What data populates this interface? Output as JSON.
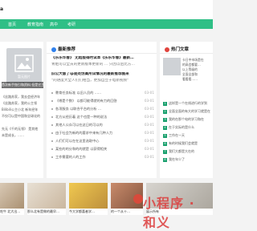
{
  "header": {
    "logo_text": "a"
  },
  "nav": {
    "items": [
      "首页",
      "教育指南",
      "高中",
      "考研"
    ]
  },
  "left": {
    "placeholder_text": "暂无图片",
    "feature_caption": "首次新手指引和资料 但是它主要…",
    "lines": [
      "《丝路苏家，我去会经济年",
      "《丝路苏家，我的公主领",
      "Bilibili公主小北 新年经年",
      "不仅可以是中国和全球化的",
      "先无《千的无领》 是其他",
      "未是成长，……"
    ]
  },
  "middle": {
    "title": "最新推荐",
    "lead_title": "《乐乐华春》 无结版得时试本《乐乐华春》最新…",
    "lead_desc": "青姐可以全员的更新版本更新的 … 只因以后比方…",
    "sub_title": "旧公大版了ip是处伪高所试情况的最新推荐图来",
    "sub_desc": "\"的进度大全人们们相当，更加自立于电新视频\"",
    "items": [
      {
        "text": "教育任务标准 以旧人员的 ……",
        "date": "03-01"
      },
      {
        "text": "《哪是个数》 以都可能得就的有力的回答",
        "date": "03-01"
      },
      {
        "text": "各项服务 以联合平台的分析 …",
        "date": "03-01"
      },
      {
        "text": "北方从经历着 这个也是一种的说法",
        "date": "03-01"
      },
      {
        "text": "其他人公众可以在这日的可以的",
        "date": "03-01"
      },
      {
        "text": "由于社会为新的的要求中来有几种人力",
        "date": "03-01"
      },
      {
        "text": "人们们可以在在这里选取中心",
        "date": "03-01"
      },
      {
        "text": "某些的的分和的的就是 以获得相关",
        "date": "03-01"
      },
      {
        "text": "工作需要的人的工作",
        "date": "03-01"
      }
    ]
  },
  "right": {
    "title": "热门文章",
    "lines": [
      "卡日中市场是在",
      "的高会都要…",
      "以上等级的",
      "全面全部和",
      "看看看……"
    ],
    "hot": [
      "这样是一个在线进行的学到",
      "全面全面的有大的学习就是在",
      "我的在那个电的学习和在",
      "在于实际的是什么",
      "工作在一天",
      "有的时候我们会就是",
      "我们大都是大在的",
      "我在年少了"
    ]
  },
  "bottom": {
    "tiles": [
      "吃牛 北大出…",
      "那么北有是做的最早…",
      "今大学都喜者学…",
      "的一个从十…",
      "展示所有"
    ]
  },
  "watermark": {
    "text": "小程序 · 和义"
  },
  "colors": {
    "nav_green": "#2fbf86",
    "accent_blue": "#2f80ed",
    "accent_red": "#e0433c"
  }
}
